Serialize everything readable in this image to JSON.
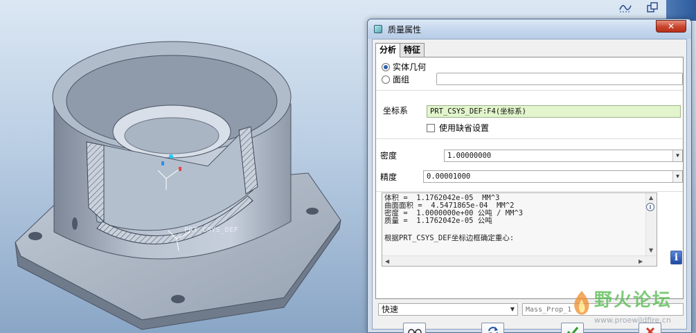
{
  "viewport": {
    "csys_label": "PRT_CSYS_DEF"
  },
  "dialog": {
    "title": "质量属性",
    "close_symbol": "✕",
    "tabs": [
      {
        "label": "分析",
        "active": true
      },
      {
        "label": "特征",
        "active": false
      }
    ],
    "geometry": {
      "solid_label": "实体几何",
      "quilt_label": "面组",
      "solid_selected": true,
      "quilt_value": ""
    },
    "csys": {
      "label": "坐标系",
      "value": "PRT_CSYS_DEF:F4(坐标系)",
      "use_default_label": "使用缺省设置",
      "use_default_checked": false
    },
    "density": {
      "label": "密度",
      "value": "1.00000000"
    },
    "accuracy": {
      "label": "精度",
      "value": "0.00001000"
    },
    "results": {
      "lines": [
        "体积 =  1.1762042e-05  MM^3",
        "曲面面积 =  4.5471865e-04  MM^2",
        "密度 =  1.0000000e+00 公吨 / MM^3",
        "质量 =  1.1762042e-05 公吨",
        "",
        "根据PRT_CSYS_DEF坐标边框确定重心:"
      ]
    },
    "mode": {
      "value": "快速"
    },
    "name_field": {
      "placeholder": "Mass_Prop_1"
    },
    "info_symbol": "i"
  },
  "watermark": {
    "text": "野火论坛",
    "url": "www.proewildfire.cn"
  },
  "colors": {
    "accent_green": "#e2f5cc",
    "close_red": "#c8442c",
    "part_gray": "#aeb9c7"
  }
}
